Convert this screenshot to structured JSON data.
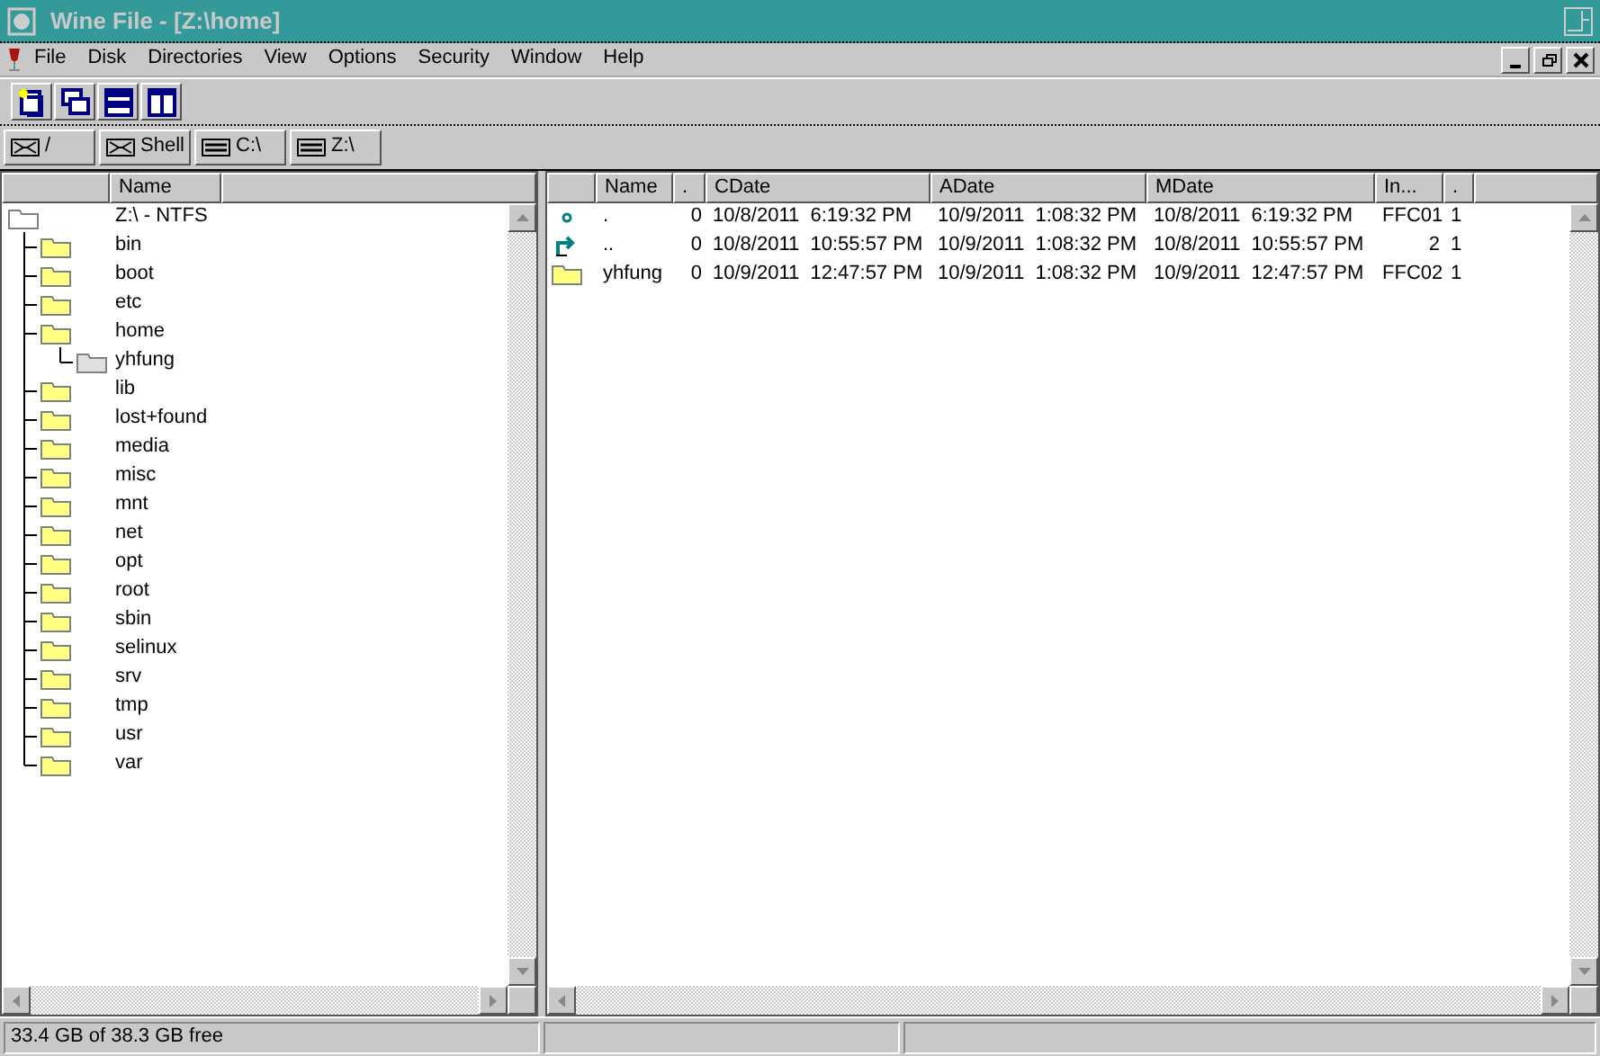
{
  "window": {
    "title": "Wine File - [Z:\\home]"
  },
  "menu": [
    "File",
    "Disk",
    "Directories",
    "View",
    "Options",
    "Security",
    "Window",
    "Help"
  ],
  "drives": [
    {
      "label": "/",
      "kind": "network"
    },
    {
      "label": "Shell",
      "kind": "network"
    },
    {
      "label": "C:\\",
      "kind": "drive"
    },
    {
      "label": "Z:\\",
      "kind": "drive"
    }
  ],
  "tree": {
    "column": "Name",
    "root": {
      "name": "Z:\\ - NTFS",
      "kind": "root",
      "children": [
        {
          "name": "bin",
          "kind": "folder"
        },
        {
          "name": "boot",
          "kind": "folder"
        },
        {
          "name": "etc",
          "kind": "folder"
        },
        {
          "name": "home",
          "kind": "folder",
          "children": [
            {
              "name": "yhfung",
              "kind": "unread"
            }
          ]
        },
        {
          "name": "lib",
          "kind": "folder"
        },
        {
          "name": "lost+found",
          "kind": "folder"
        },
        {
          "name": "media",
          "kind": "folder"
        },
        {
          "name": "misc",
          "kind": "folder"
        },
        {
          "name": "mnt",
          "kind": "folder"
        },
        {
          "name": "net",
          "kind": "folder"
        },
        {
          "name": "opt",
          "kind": "folder"
        },
        {
          "name": "root",
          "kind": "folder"
        },
        {
          "name": "sbin",
          "kind": "folder"
        },
        {
          "name": "selinux",
          "kind": "folder"
        },
        {
          "name": "srv",
          "kind": "folder"
        },
        {
          "name": "tmp",
          "kind": "folder"
        },
        {
          "name": "usr",
          "kind": "folder"
        },
        {
          "name": "var",
          "kind": "folder"
        }
      ]
    }
  },
  "files": {
    "columns": [
      "Name",
      ".",
      "CDate",
      "ADate",
      "MDate",
      "In...",
      "."
    ],
    "rows": [
      {
        "kind": "dot",
        "cells": [
          ".",
          "0",
          "10/8/2011  6:19:32 PM",
          "10/9/2011  1:08:32 PM",
          "10/8/2011  6:19:32 PM",
          "FFC01",
          "1"
        ]
      },
      {
        "kind": "up",
        "cells": [
          "..",
          "0",
          "10/8/2011  10:55:57 PM",
          "10/9/2011  1:08:32 PM",
          "10/8/2011  10:55:57 PM",
          "2",
          "1"
        ]
      },
      {
        "kind": "folder",
        "cells": [
          "yhfung",
          "0",
          "10/9/2011  12:47:57 PM",
          "10/9/2011  1:08:32 PM",
          "10/9/2011  12:47:57 PM",
          "FFC02",
          "1"
        ]
      }
    ]
  },
  "status_bar": [
    "33.4 GB of 38.3 GB free"
  ]
}
